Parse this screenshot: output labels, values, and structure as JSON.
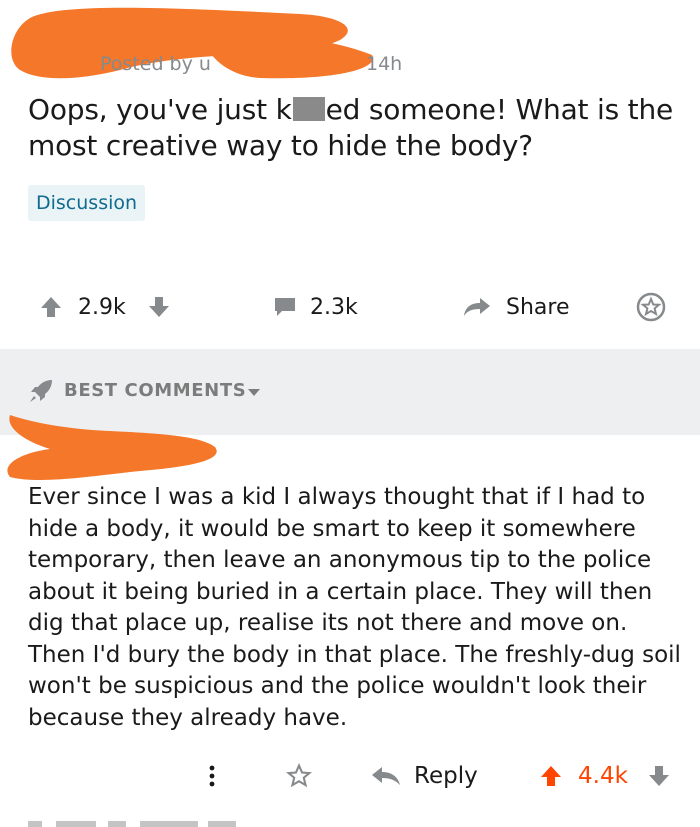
{
  "post": {
    "meta_prefix": "Posted by u",
    "age": "14h",
    "title_part1": "Oops, you've just k",
    "title_part2": "ed someone! What is the most creative way to hide the body?",
    "flair": "Discussion"
  },
  "actions": {
    "upvotes": "2.9k",
    "comments": "2.3k",
    "share_label": "Share"
  },
  "comments_section": {
    "sort_label": "BEST COMMENTS"
  },
  "comment": {
    "body": "Ever since I was a kid I always thought that if I had to hide a body, it would be smart to keep it somewhere temporary, then leave an anonymous tip to the police about it being buried in a certain place. They will then dig that place up, realise its not there and move on. Then I'd bury the body in that place. The freshly-dug soil won't be suspicious and the police wouldn't look their because they already have.",
    "reply_label": "Reply",
    "score": "4.4k"
  },
  "colors": {
    "upvote_accent": "#ff4500",
    "icon_gray": "#878a8c",
    "redaction_orange": "#f4772a",
    "flair_bg": "#eaf3f6",
    "flair_text": "#0f6b8f"
  },
  "icons": [
    "arrow-up-icon",
    "arrow-down-icon",
    "comment-bubble-icon",
    "share-arrow-icon",
    "star-icon",
    "rocket-icon",
    "caret-down-icon",
    "more-vertical-icon",
    "reply-arrow-icon"
  ]
}
